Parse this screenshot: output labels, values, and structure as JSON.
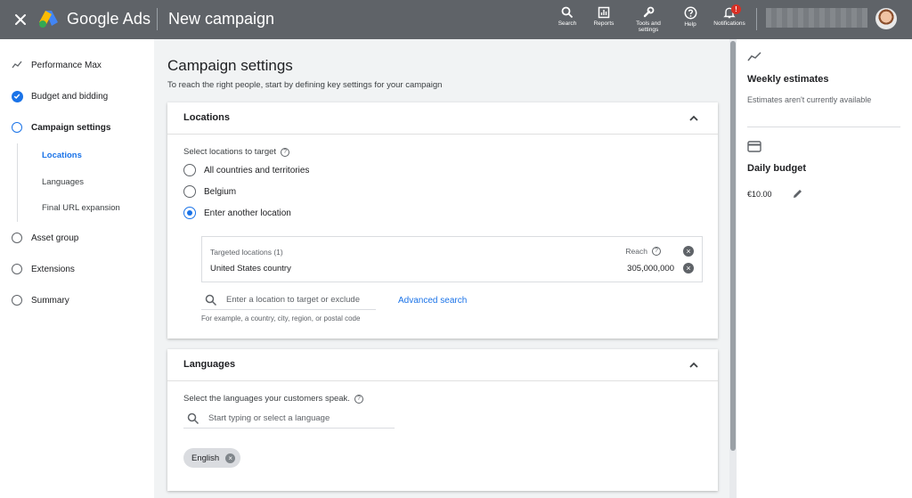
{
  "header": {
    "brand": "Google Ads",
    "page_title": "New campaign",
    "tools": [
      {
        "label": "Search",
        "icon": "search-icon"
      },
      {
        "label": "Reports",
        "icon": "reports-icon"
      },
      {
        "label": "Tools and settings",
        "icon": "wrench-icon"
      },
      {
        "label": "Help",
        "icon": "help-icon"
      },
      {
        "label": "Notifications",
        "icon": "bell-icon",
        "badge": "!"
      }
    ]
  },
  "sidebar": {
    "items": [
      {
        "label": "Performance Max",
        "state": "type"
      },
      {
        "label": "Budget and bidding",
        "state": "done"
      },
      {
        "label": "Campaign settings",
        "state": "current"
      },
      {
        "label": "Asset group",
        "state": "todo"
      },
      {
        "label": "Extensions",
        "state": "todo"
      },
      {
        "label": "Summary",
        "state": "todo"
      }
    ],
    "sub_items": [
      {
        "label": "Locations",
        "active": true
      },
      {
        "label": "Languages",
        "active": false
      },
      {
        "label": "Final URL expansion",
        "active": false
      }
    ]
  },
  "main": {
    "title": "Campaign settings",
    "subtitle": "To reach the right people, start by defining key settings for your campaign",
    "locations": {
      "title": "Locations",
      "hint": "Select locations to target",
      "options": [
        {
          "label": "All countries and territories",
          "selected": false
        },
        {
          "label": "Belgium",
          "selected": false
        },
        {
          "label": "Enter another location",
          "selected": true
        }
      ],
      "targeted_header": "Targeted locations (1)",
      "reach_label": "Reach",
      "targeted_location": "United States country",
      "reach_value": "305,000,000",
      "search_placeholder": "Enter a location to target or exclude",
      "advanced_search": "Advanced search",
      "example": "For example, a country, city, region, or postal code"
    },
    "languages": {
      "title": "Languages",
      "hint": "Select the languages your customers speak.",
      "search_placeholder": "Start typing or select a language",
      "chip": "English"
    }
  },
  "right_panel": {
    "weekly_title": "Weekly estimates",
    "weekly_text": "Estimates aren't currently available",
    "budget_title": "Daily budget",
    "budget_value": "€10.00"
  },
  "colors": {
    "topbar": "#5f6368",
    "accent": "#1a73e8"
  }
}
